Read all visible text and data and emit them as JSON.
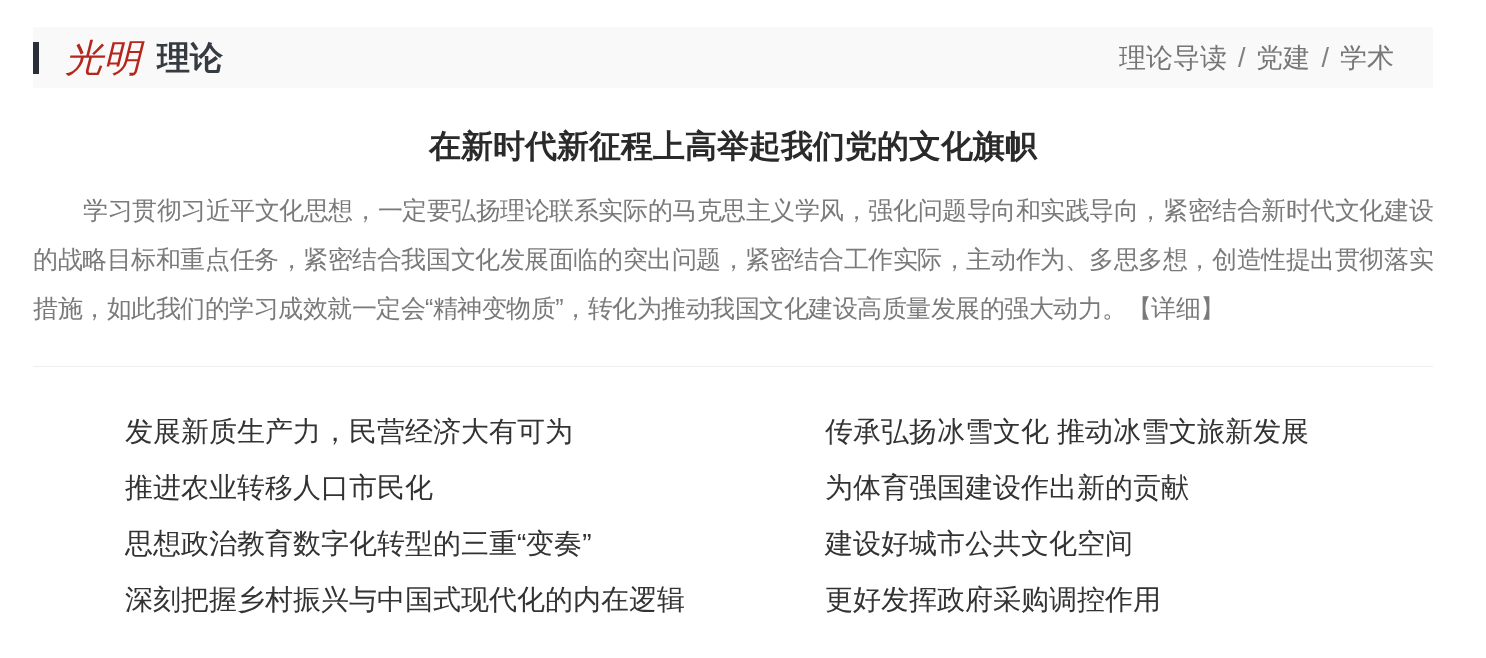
{
  "header": {
    "logo": {
      "brand": "光明",
      "section": "理论"
    },
    "nav": [
      {
        "kind": "link",
        "text": "理论导读"
      },
      {
        "kind": "separator",
        "text": "/"
      },
      {
        "kind": "link",
        "text": "党建"
      },
      {
        "kind": "separator",
        "text": "/"
      },
      {
        "kind": "link",
        "text": "学术"
      }
    ]
  },
  "headline": {
    "title": "在新时代新征程上高举起我们党的文化旗帜",
    "summary": "学习贯彻习近平文化思想，一定要弘扬理论联系实际的马克思主义学风，强化问题导向和实践导向，紧密结合新时代文化建设的战略目标和重点任务，紧密结合我国文化发展面临的突出问题，紧密结合工作实际，主动作为、多思多想，创造性提出贯彻落实措施，如此我们的学习成效就一定会“精神变物质”，转化为推动我国文化建设高质量发展的强大动力。",
    "more_link": "【详细】"
  },
  "article_columns": [
    {
      "items": [
        "发展新质生产力，民营经济大有可为",
        "推进农业转移人口市民化",
        "思想政治教育数字化转型的三重“变奏”",
        "深刻把握乡村振兴与中国式现代化的内在逻辑"
      ]
    },
    {
      "items": [
        "传承弘扬冰雪文化 推动冰雪文旅新发展",
        "为体育强国建设作出新的贡献",
        "建设好城市公共文化空间",
        "更好发挥政府采购调控作用"
      ]
    }
  ]
}
